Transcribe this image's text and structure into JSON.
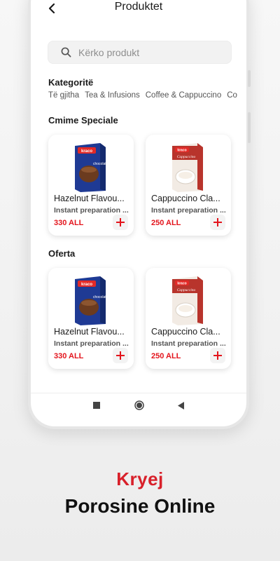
{
  "header": {
    "title": "Produktet"
  },
  "search": {
    "placeholder": "Kërko produkt"
  },
  "categories": {
    "title": "Kategoritë",
    "items": [
      "Të gjitha",
      "Tea & Infusions",
      "Coffee & Cappuccino",
      "Co"
    ]
  },
  "sections": [
    {
      "title": "Cmime Speciale",
      "products": [
        {
          "name": "Hazelnut Flavou...",
          "desc": "Instant preparation ...",
          "price": "330 ALL",
          "image": "hot-chocolate-box"
        },
        {
          "name": "Cappuccino Cla...",
          "desc": "Instant preparation ...",
          "price": "250 ALL",
          "image": "cappuccino-box"
        }
      ]
    },
    {
      "title": "Oferta",
      "products": [
        {
          "name": "Hazelnut Flavou...",
          "desc": "Instant preparation ...",
          "price": "330 ALL",
          "image": "hot-chocolate-box"
        },
        {
          "name": "Cappuccino Cla...",
          "desc": "Instant preparation ...",
          "price": "250 ALL",
          "image": "cappuccino-box"
        }
      ]
    }
  ],
  "promo": {
    "line1": "Kryej",
    "line2": "Porosine Online"
  },
  "colors": {
    "accent": "#e3141c",
    "promo_red": "#d8202a",
    "text": "#1b1b1b"
  },
  "icons": [
    "back-arrow-icon",
    "search-icon",
    "plus-icon",
    "square-icon",
    "circle-icon",
    "triangle-left-icon"
  ]
}
